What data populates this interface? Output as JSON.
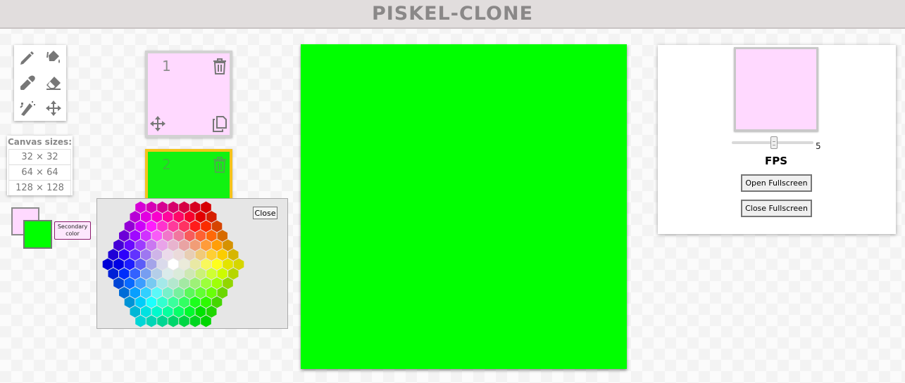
{
  "app": {
    "title": "PISKEL-CLONE"
  },
  "tools": [
    {
      "name": "pencil-icon"
    },
    {
      "name": "paint-bucket-icon"
    },
    {
      "name": "eyedropper-icon"
    },
    {
      "name": "eraser-icon"
    },
    {
      "name": "magic-tools-icon"
    },
    {
      "name": "move-icon"
    }
  ],
  "canvas_sizes": {
    "title": "Canvas sizes:",
    "options": [
      "32 × 32",
      "64 × 64",
      "128 × 128"
    ]
  },
  "colors": {
    "primary": "#ffd9ff",
    "secondary": "#00ff00",
    "secondary_tooltip": "Secondary color"
  },
  "frames": [
    {
      "number": "1",
      "color": "#ffd9ff"
    },
    {
      "number": "2",
      "color": "#00ff00",
      "selected": true
    }
  ],
  "color_picker": {
    "close_label": "Close"
  },
  "preview": {
    "fps_value": "5",
    "fps_label": "FPS",
    "open_fullscreen": "Open Fullscreen",
    "close_fullscreen": "Close Fullscreen"
  }
}
